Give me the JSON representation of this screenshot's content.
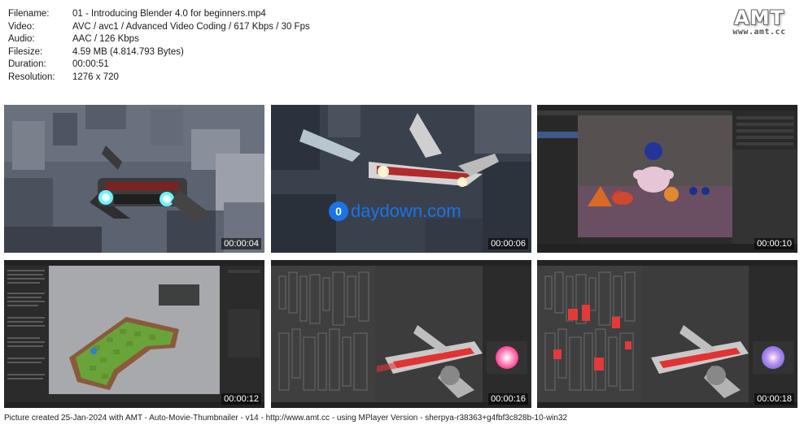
{
  "info": {
    "rows": [
      {
        "key": "Filename:",
        "value": "01 - Introducing Blender 4.0 for beginners.mp4"
      },
      {
        "key": "Video:",
        "value": "AVC / avc1 / Advanced Video Coding / 617 Kbps / 30 Fps"
      },
      {
        "key": "Audio:",
        "value": "AAC / 126 Kbps"
      },
      {
        "key": "Filesize:",
        "value": "4.59 MB (4.814.793 Bytes)"
      },
      {
        "key": "Duration:",
        "value": "00:00:51"
      },
      {
        "key": "Resolution:",
        "value": "1276 x 720"
      }
    ]
  },
  "logo": {
    "title": "AMT",
    "url": "www.amt.cc"
  },
  "thumbnails": [
    {
      "time": "00:00:04"
    },
    {
      "time": "00:00:06",
      "watermark": "daydown.com"
    },
    {
      "time": "00:00:10"
    },
    {
      "time": "00:00:12"
    },
    {
      "time": "00:00:16"
    },
    {
      "time": "00:00:18"
    }
  ],
  "footer": "Picture created 25-Jan-2024 with AMT - Auto-Movie-Thumbnailer - v14 - http://www.amt.cc - using MPlayer Version - sherpya-r38363+g4fbf3c828b-10-win32"
}
